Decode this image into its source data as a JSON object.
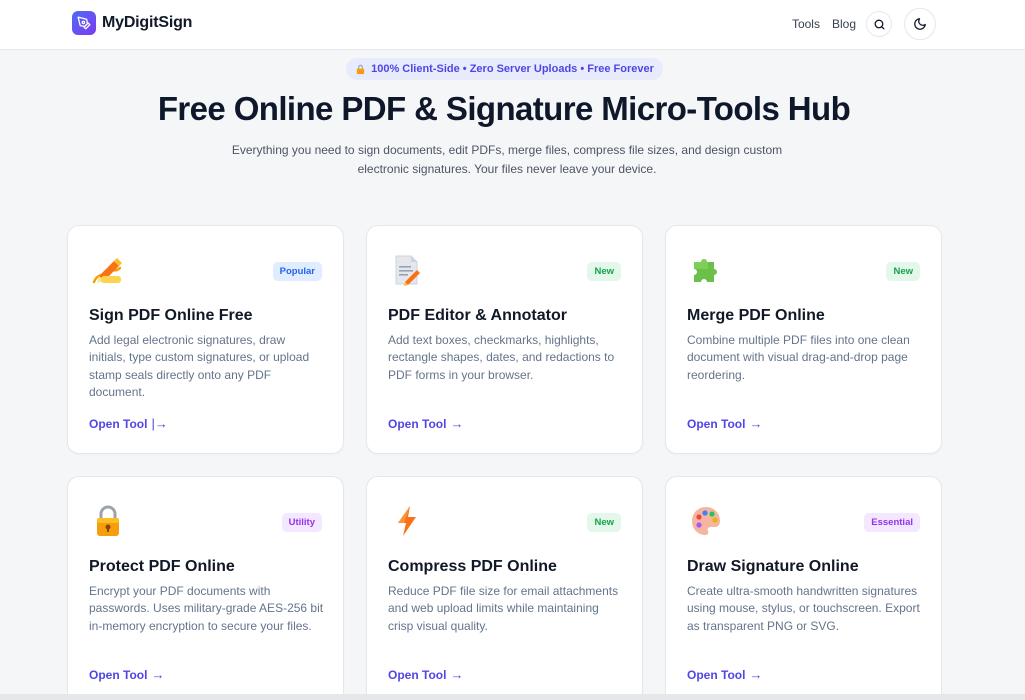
{
  "header": {
    "brand": "MyDigitSign",
    "nav": {
      "tools": "Tools",
      "blog": "Blog"
    }
  },
  "hero": {
    "badge": "100% Client-Side • Zero Server Uploads • Free Forever",
    "title": "Free Online PDF & Signature Micro-Tools Hub",
    "subtitle": "Everything you need to sign documents, edit PDFs, merge files, compress file sizes, and design custom electronic signatures. Your files never leave your device."
  },
  "cards": [
    {
      "icon": "pen-signature-icon",
      "tag": "Popular",
      "title": "Sign PDF Online Free",
      "description": "Add legal electronic signatures, draw initials, type custom signatures, or upload stamp seals directly onto any PDF document.",
      "link": "Open Tool"
    },
    {
      "icon": "document-edit-icon",
      "tag": "New",
      "title": "PDF Editor & Annotator",
      "description": "Add text boxes, checkmarks, highlights, rectangle shapes, dates, and redactions to PDF forms in your browser.",
      "link": "Open Tool"
    },
    {
      "icon": "puzzle-icon",
      "tag": "New",
      "title": "Merge PDF Online",
      "description": "Combine multiple PDF files into one clean document with visual drag-and-drop page reordering.",
      "link": "Open Tool"
    },
    {
      "icon": "lock-icon",
      "tag": "Utility",
      "title": "Protect PDF Online",
      "description": "Encrypt your PDF documents with passwords. Uses military-grade AES-256 bit in-memory encryption to secure your files.",
      "link": "Open Tool"
    },
    {
      "icon": "lightning-icon",
      "tag": "New",
      "title": "Compress PDF Online",
      "description": "Reduce PDF file size for email attachments and web upload limits while maintaining crisp visual quality.",
      "link": "Open Tool"
    },
    {
      "icon": "palette-icon",
      "tag": "Essential",
      "title": "Draw Signature Online",
      "description": "Create ultra-smooth handwritten signatures using mouse, stylus, or touchscreen. Export as transparent PNG or SVG.",
      "link": "Open Tool"
    }
  ],
  "colors": {
    "accent": "#4f46e5",
    "popular": "#2563eb",
    "new": "#16a34a",
    "utility": "#9333ea"
  }
}
